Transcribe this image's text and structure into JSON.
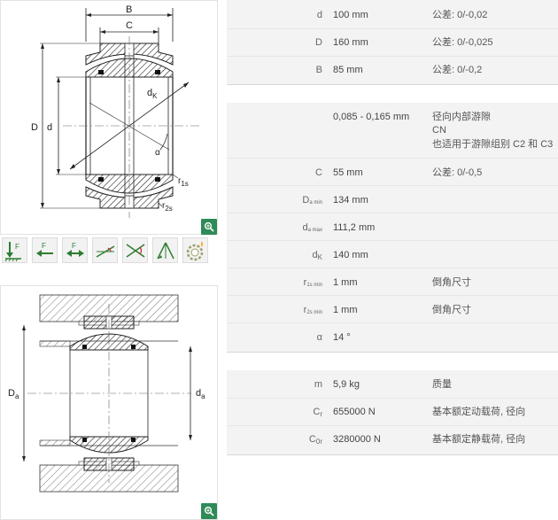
{
  "diagram_top": {
    "labels": {
      "B": "B",
      "C": "C",
      "D": "D",
      "d": "d",
      "dK": "d",
      "dK_sub": "K",
      "alpha": "α",
      "r1s": "r",
      "r1s_sub": "1s",
      "r2s": "r",
      "r2s_sub": "2s"
    }
  },
  "diagram_bottom": {
    "labels": {
      "Da": "D",
      "Da_sub": "a",
      "da": "d",
      "da_sub": "a"
    }
  },
  "icons": [
    {
      "name": "radial-load-icon"
    },
    {
      "name": "axial-load-left-icon"
    },
    {
      "name": "axial-load-both-icon"
    },
    {
      "name": "tilt-angle-icon"
    },
    {
      "name": "misalignment-icon"
    },
    {
      "name": "oscillation-icon"
    },
    {
      "name": "maintenance-free-icon"
    }
  ],
  "dimensions": [
    {
      "label": "d",
      "value": "100  mm",
      "note": "公差: 0/-0,02"
    },
    {
      "label": "D",
      "value": "160  mm",
      "note": "公差: 0/-0,025"
    },
    {
      "label": "B",
      "value": "85  mm",
      "note": "公差: 0/-0,2"
    }
  ],
  "details": {
    "clearance": {
      "value": "0,085 - 0,165  mm",
      "note_lines": [
        "径向内部游隙",
        "CN",
        "也适用于游隙组别 C2 和 C3"
      ]
    },
    "rows": [
      {
        "label": "C",
        "sub": "",
        "value": "55  mm",
        "note": "公差: 0/-0,5"
      },
      {
        "label": "D",
        "sub": "a min",
        "value": "134  mm",
        "note": ""
      },
      {
        "label": "d",
        "sub": "a max",
        "value": "111,2  mm",
        "note": ""
      },
      {
        "label": "d",
        "sub": "K",
        "value": "140  mm",
        "note": ""
      },
      {
        "label": "r",
        "sub": "1s min",
        "value": "1  mm",
        "note": "倒角尺寸"
      },
      {
        "label": "r",
        "sub": "2s min",
        "value": "1  mm",
        "note": "倒角尺寸"
      },
      {
        "label": "α",
        "sub": "",
        "value": "14  °",
        "note": ""
      }
    ]
  },
  "loads": [
    {
      "label": "m",
      "sub": "",
      "value": "5,9  kg",
      "note": "质量"
    },
    {
      "label": "C",
      "sub": "r",
      "value": "655000  N",
      "note": "基本额定动载荷, 径向"
    },
    {
      "label": "C",
      "sub": "0r",
      "value": "3280000  N",
      "note": "基本额定静载荷, 径向"
    }
  ]
}
